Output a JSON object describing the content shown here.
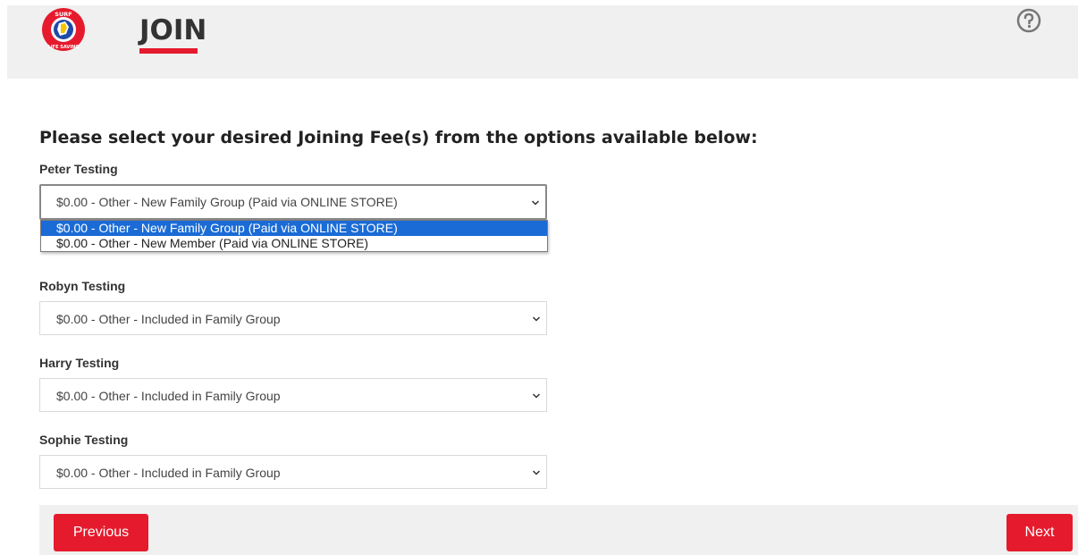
{
  "header": {
    "title": "JOIN",
    "logo": {
      "name": "surf-life-saving-logo",
      "text_top": "SURF",
      "text_bottom": "LIFE SAVING"
    },
    "help_icon": "question-circle-icon"
  },
  "heading": "Please select your desired Joining Fee(s) from the options available below:",
  "members": [
    {
      "name": "Peter Testing",
      "selected": "$0.00 - Other - New Family Group (Paid via ONLINE STORE)",
      "options": [
        "$0.00 - Other - New Family Group (Paid via ONLINE STORE)",
        "$0.00 - Other - New Member (Paid via ONLINE STORE)"
      ]
    },
    {
      "name": "Robyn Testing",
      "selected": "$0.00 - Other - Included in Family Group"
    },
    {
      "name": "Harry Testing",
      "selected": "$0.00 - Other - Included in Family Group"
    },
    {
      "name": "Sophie Testing",
      "selected": "$0.00 - Other - Included in Family Group"
    }
  ],
  "buttons": {
    "previous": "Previous",
    "next": "Next"
  },
  "colors": {
    "accent": "#e51b2d",
    "highlight": "#1a6bd6",
    "panel": "#f0f0f0"
  }
}
